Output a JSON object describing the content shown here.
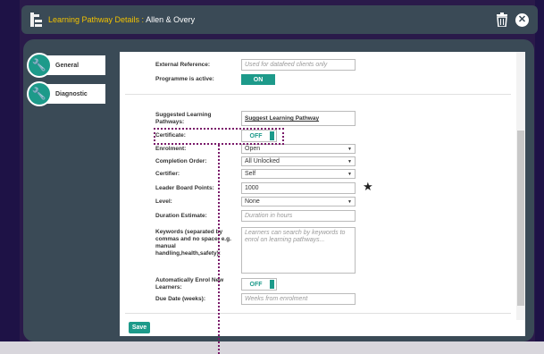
{
  "titlebar": {
    "title_prefix": "Learning Pathway Details : ",
    "title_name": "Allen & Overy"
  },
  "icons": {
    "title": "pathway-icon",
    "trash": "trash-icon",
    "close": "close-icon",
    "tab": "wrench-icon"
  },
  "sidebar": {
    "tabs": [
      {
        "label": "General"
      },
      {
        "label": "Diagnostic"
      }
    ]
  },
  "form": {
    "external_reference": {
      "label": "External Reference:",
      "placeholder": "Used for datafeed clients only"
    },
    "programme_active": {
      "label": "Programme is active:",
      "value": "ON"
    },
    "suggested_pathways": {
      "label": "Suggested Learning Pathways:",
      "value": "Suggest Learning Pathway"
    },
    "certificate": {
      "label": "Certificate:",
      "value": "OFF"
    },
    "enrolment": {
      "label": "Enrolment:",
      "value": "Open"
    },
    "completion_order": {
      "label": "Completion Order:",
      "value": "All Unlocked"
    },
    "certifier": {
      "label": "Certifier:",
      "value": "Self"
    },
    "leader_board": {
      "label": "Leader Board Points:",
      "value": "1000",
      "marker": "★"
    },
    "level": {
      "label": "Level:",
      "value": "None"
    },
    "duration": {
      "label": "Duration Estimate:",
      "placeholder": "Duration in hours"
    },
    "keywords": {
      "label": "Keywords (separated by commas and no space; e.g. manual handling,health,safety):",
      "placeholder": "Learners can search by keywords to enrol on learning pathways..."
    },
    "auto_enrol": {
      "label": "Automatically Enrol New Learners:",
      "value": "OFF"
    },
    "due_date": {
      "label": "Due Date (weeks):",
      "placeholder": "Weeks from enrolment"
    },
    "save_label": "Save"
  },
  "colors": {
    "accent": "#1d9a8a",
    "title_highlight": "#f2c200",
    "dialog": "#3a4a56",
    "callout": "#7a1a6a"
  }
}
